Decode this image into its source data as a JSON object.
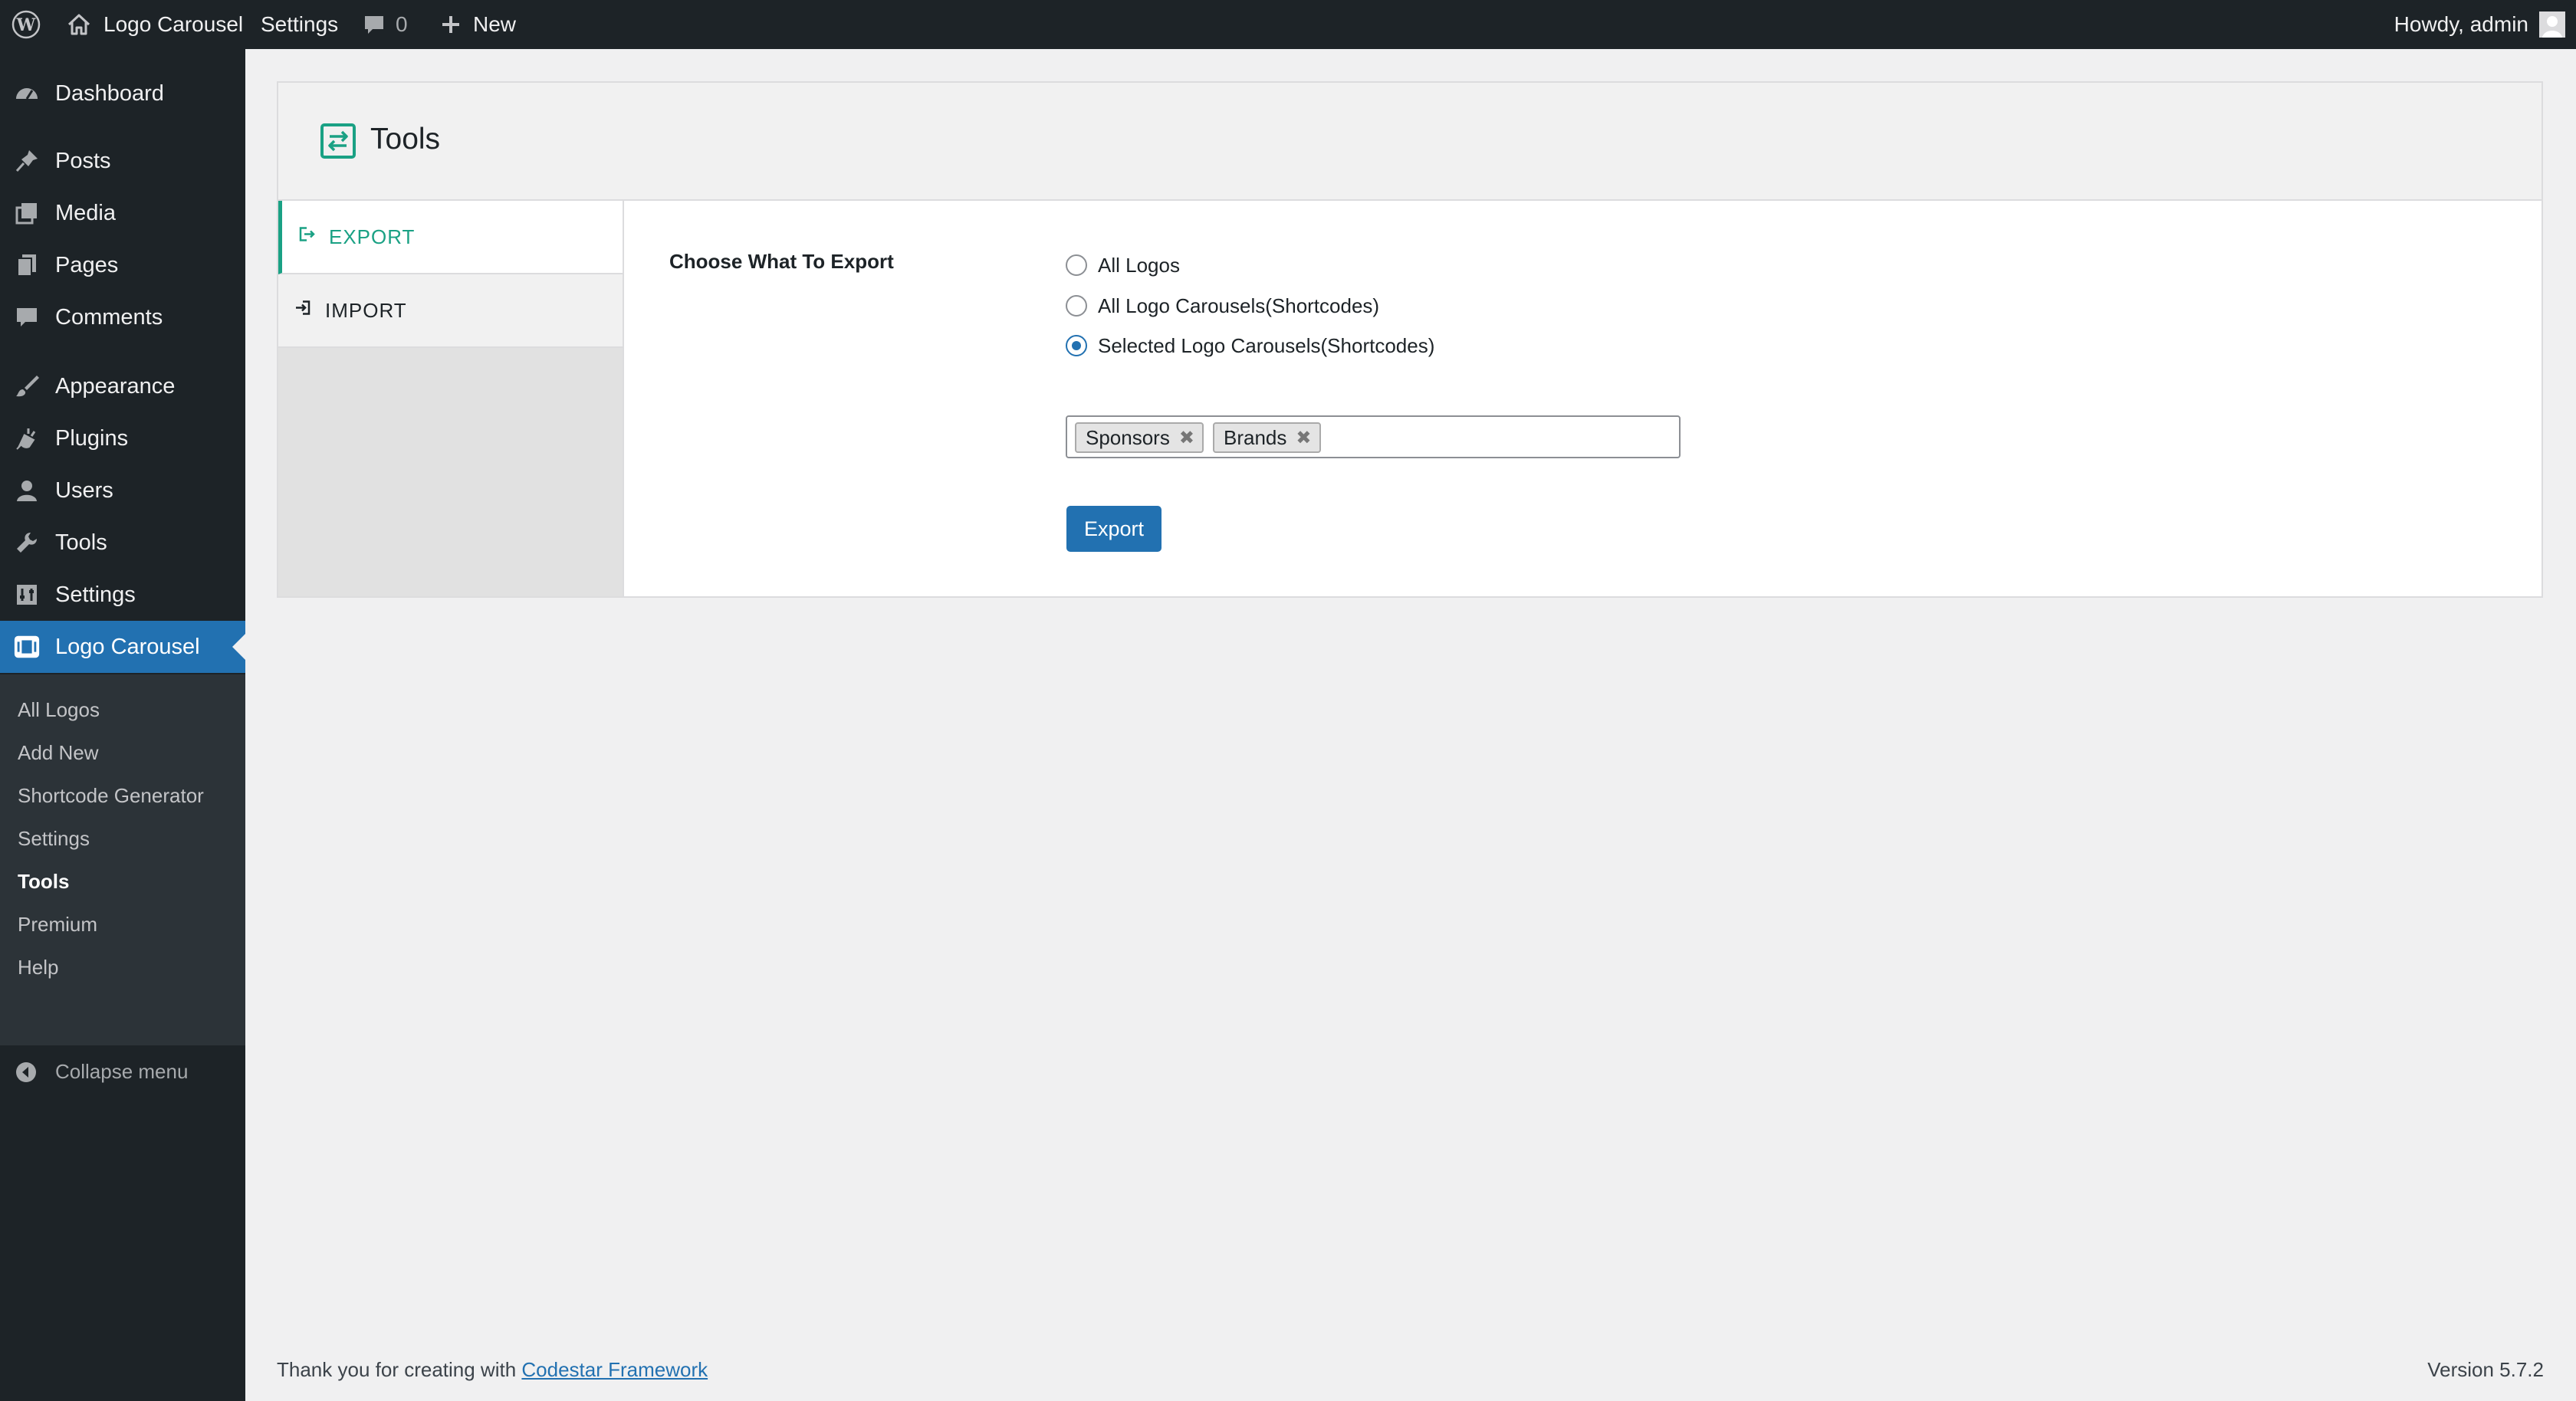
{
  "adminbar": {
    "site_name": "Logo Carousel",
    "settings": "Settings",
    "comments_count": "0",
    "new_label": "New",
    "greeting": "Howdy, admin"
  },
  "sidebar": {
    "items": [
      {
        "label": "Dashboard",
        "icon": "dashboard-icon"
      },
      {
        "label": "Posts",
        "icon": "pin-icon"
      },
      {
        "label": "Media",
        "icon": "media-icon"
      },
      {
        "label": "Pages",
        "icon": "pages-icon"
      },
      {
        "label": "Comments",
        "icon": "comment-icon"
      },
      {
        "label": "Appearance",
        "icon": "brush-icon"
      },
      {
        "label": "Plugins",
        "icon": "plugin-icon"
      },
      {
        "label": "Users",
        "icon": "user-icon"
      },
      {
        "label": "Tools",
        "icon": "wrench-icon"
      },
      {
        "label": "Settings",
        "icon": "settings-icon"
      },
      {
        "label": "Logo Carousel",
        "icon": "carousel-icon"
      }
    ],
    "submenu": [
      "All Logos",
      "Add New",
      "Shortcode Generator",
      "Settings",
      "Tools",
      "Premium",
      "Help"
    ],
    "collapse_label": "Collapse menu"
  },
  "panel": {
    "title": "Tools",
    "tabs": [
      {
        "label": "EXPORT",
        "icon": "export-icon"
      },
      {
        "label": "IMPORT",
        "icon": "import-icon"
      }
    ],
    "field_title": "Choose What To Export",
    "options": [
      {
        "label": "All Logos",
        "checked": false
      },
      {
        "label": "All Logo Carousels(Shortcodes)",
        "checked": false
      },
      {
        "label": "Selected Logo Carousels(Shortcodes)",
        "checked": true
      }
    ],
    "selected_tokens": [
      "Sponsors",
      "Brands"
    ],
    "export_button": "Export"
  },
  "footer": {
    "thanks": "Thank you for creating with",
    "link": "Codestar Framework",
    "version": "Version 5.7.2"
  },
  "colors": {
    "admin_dark": "#1d2327",
    "wp_blue": "#2271b1",
    "accent_green": "#1aa184"
  }
}
